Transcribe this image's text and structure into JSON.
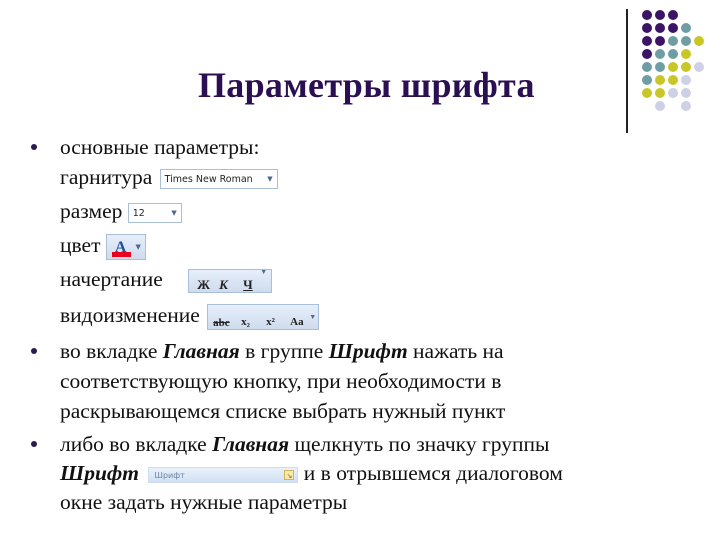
{
  "slide": {
    "title": "Параметры шрифта",
    "accent_color": "#2a0f52",
    "decoration": {
      "dot_colors": {
        "P": "#3b1466",
        "T": "#6e9ea3",
        "Y": "#c9c728",
        "L": "#cdd0e6"
      },
      "dot_rows": [
        "PPP",
        "PPPT",
        "PPTTY",
        "PTTY",
        "TTYYL",
        "TYYL",
        "YYLL",
        "_L_L"
      ]
    }
  },
  "bullets": [
    {
      "text": "основные параметры:",
      "items": [
        {
          "label": "гарнитура",
          "widget": "font-dropdown",
          "value": "Times New Roman"
        },
        {
          "label": "размер",
          "widget": "size-dropdown",
          "value": "12"
        },
        {
          "label": "цвет",
          "widget": "font-color-button",
          "value": "A",
          "color": "#e8001c"
        },
        {
          "label": "начертание",
          "widget": "font-style-group",
          "buttons": [
            "Ж",
            "К",
            "Ч"
          ]
        },
        {
          "label": "видоизменение",
          "widget": "font-effects-group",
          "buttons": [
            "abc",
            "x₂",
            "x²",
            "Aa"
          ]
        }
      ]
    },
    {
      "lines": [
        {
          "pre": "во вкладке ",
          "em1": "Главная",
          "mid": " в группе ",
          "em2": "Шрифт",
          "post": " нажать на"
        },
        {
          "text": "соответствующую кнопку, при необходимости в"
        },
        {
          "text": "раскрывающемся списке выбрать нужный пункт"
        }
      ]
    },
    {
      "lines": [
        {
          "pre": "либо во вкладке ",
          "em1": "Главная",
          "post": " щелкнуть по значку группы"
        },
        {
          "em": "Шрифт",
          "group_label": "Шрифт",
          "post": " и в отрывшемся диалоговом"
        },
        {
          "text": "окне задать нужные параметры"
        }
      ]
    }
  ]
}
